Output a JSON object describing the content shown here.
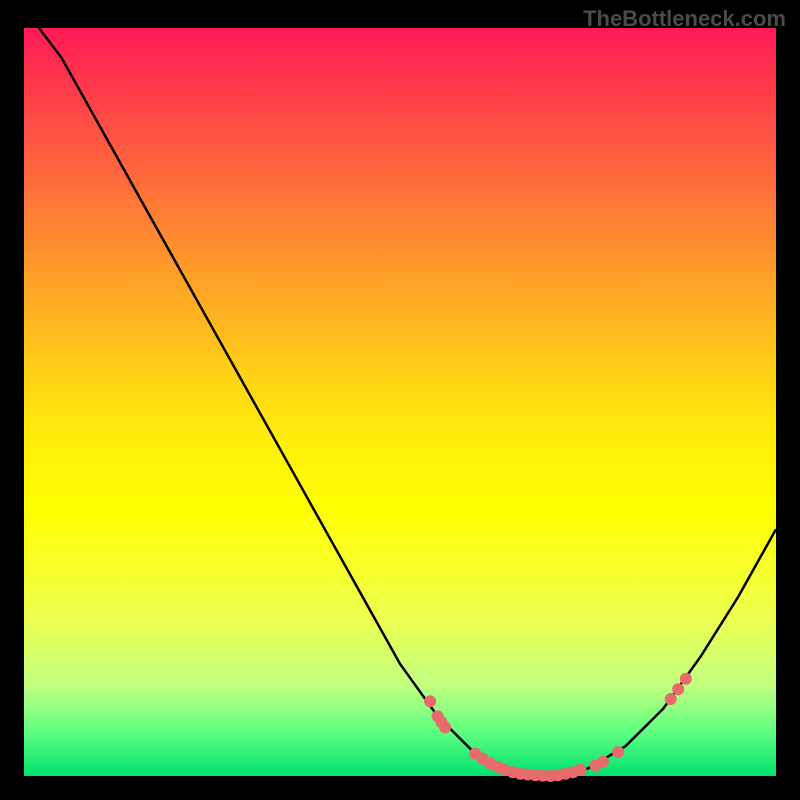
{
  "attribution": "TheBottleneck.com",
  "chart_data": {
    "type": "line",
    "title": "",
    "xlabel": "",
    "ylabel": "",
    "x_range": [
      0,
      100
    ],
    "y_range": [
      0,
      100
    ],
    "curve": [
      {
        "x": 2,
        "y": 100
      },
      {
        "x": 5,
        "y": 96
      },
      {
        "x": 10,
        "y": 87
      },
      {
        "x": 15,
        "y": 78
      },
      {
        "x": 20,
        "y": 69
      },
      {
        "x": 25,
        "y": 60
      },
      {
        "x": 30,
        "y": 51
      },
      {
        "x": 35,
        "y": 42
      },
      {
        "x": 40,
        "y": 33
      },
      {
        "x": 45,
        "y": 24
      },
      {
        "x": 50,
        "y": 15
      },
      {
        "x": 55,
        "y": 8
      },
      {
        "x": 60,
        "y": 3
      },
      {
        "x": 65,
        "y": 0.5
      },
      {
        "x": 70,
        "y": 0
      },
      {
        "x": 75,
        "y": 1
      },
      {
        "x": 80,
        "y": 4
      },
      {
        "x": 85,
        "y": 9
      },
      {
        "x": 90,
        "y": 16
      },
      {
        "x": 95,
        "y": 24
      },
      {
        "x": 100,
        "y": 33
      }
    ],
    "dots": [
      {
        "x": 54,
        "y": 10
      },
      {
        "x": 55,
        "y": 8
      },
      {
        "x": 55.5,
        "y": 7.2
      },
      {
        "x": 56,
        "y": 6.5
      },
      {
        "x": 60,
        "y": 3
      },
      {
        "x": 61,
        "y": 2.3
      },
      {
        "x": 62,
        "y": 1.7
      },
      {
        "x": 63,
        "y": 1.2
      },
      {
        "x": 64,
        "y": 0.8
      },
      {
        "x": 65,
        "y": 0.5
      },
      {
        "x": 66,
        "y": 0.3
      },
      {
        "x": 67,
        "y": 0.2
      },
      {
        "x": 68,
        "y": 0.1
      },
      {
        "x": 69,
        "y": 0.05
      },
      {
        "x": 70,
        "y": 0
      },
      {
        "x": 71,
        "y": 0.1
      },
      {
        "x": 72,
        "y": 0.3
      },
      {
        "x": 73,
        "y": 0.5
      },
      {
        "x": 74,
        "y": 0.8
      },
      {
        "x": 76,
        "y": 1.4
      },
      {
        "x": 77,
        "y": 1.9
      },
      {
        "x": 79,
        "y": 3.2
      },
      {
        "x": 86,
        "y": 10.3
      },
      {
        "x": 87,
        "y": 11.6
      },
      {
        "x": 88,
        "y": 13
      }
    ],
    "dot_color": "#e86a6a"
  }
}
